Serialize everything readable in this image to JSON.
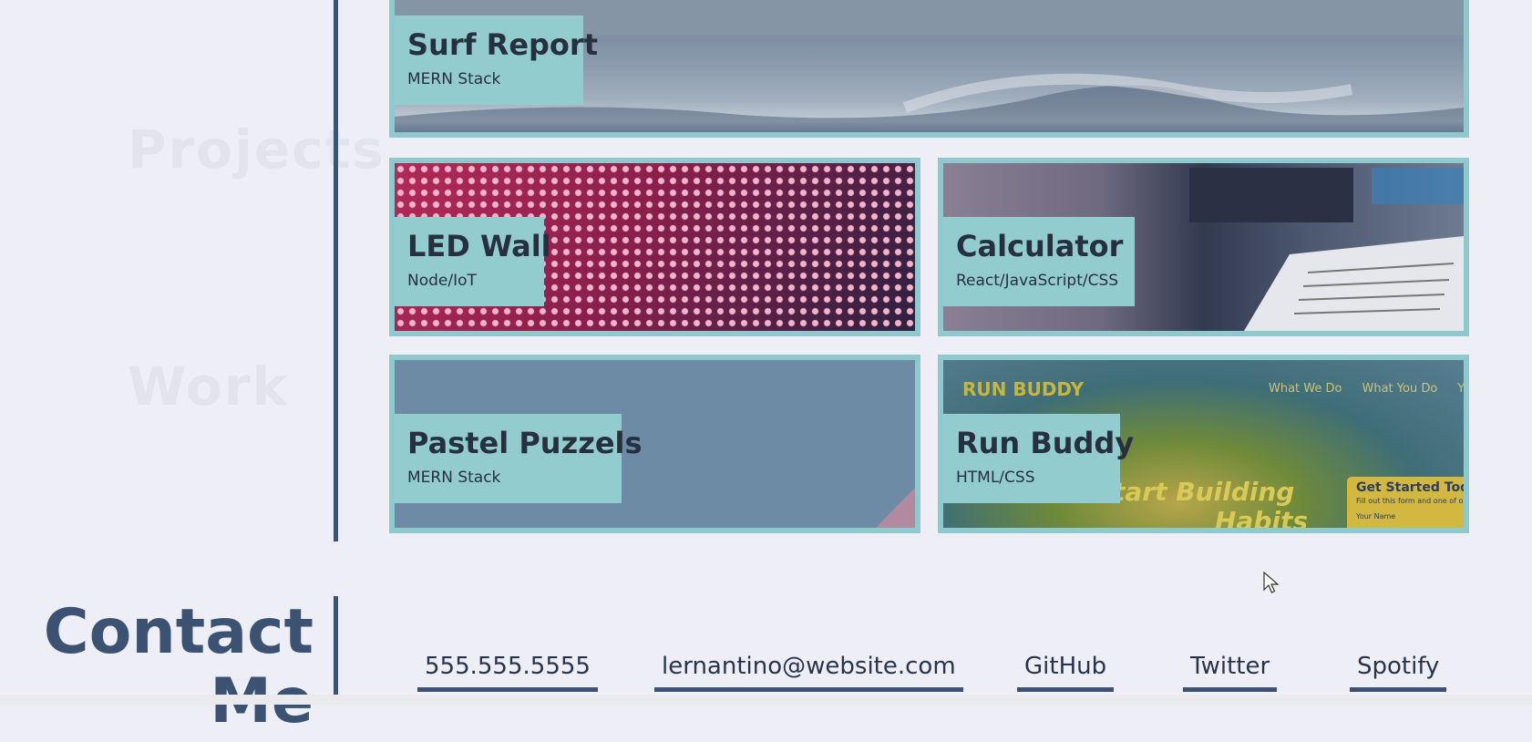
{
  "projects": [
    {
      "title": "Surf Report",
      "stack": "MERN Stack"
    },
    {
      "title": "LED Wall",
      "stack": "Node/IoT"
    },
    {
      "title": "Calculator",
      "stack": "React/JavaScript/CSS"
    },
    {
      "title": "Pastel Puzzels",
      "stack": "MERN Stack"
    },
    {
      "title": "Run Buddy",
      "stack": "HTML/CSS"
    }
  ],
  "run_buddy_screenshot": {
    "logo": "RUN BUDDY",
    "nav": [
      "What We Do",
      "What You Do",
      "Yo"
    ],
    "hero_text": "tart Building",
    "hero_text2": "Habits",
    "cta_title": "Get Started Today",
    "cta_text": "Fill out this form and one of o",
    "cta_field": "Your Name"
  },
  "contact": {
    "heading_line1": "Contact",
    "heading_line2": "Me",
    "links": [
      "555.555.5555",
      "lernantino@website.com",
      "GitHub",
      "Twitter",
      "Spotify"
    ]
  },
  "colors": {
    "accent": "#8ecacd",
    "primary": "#3c5272",
    "background": "#eeeef6"
  },
  "cursor_icon": "pointer-arrow-icon"
}
